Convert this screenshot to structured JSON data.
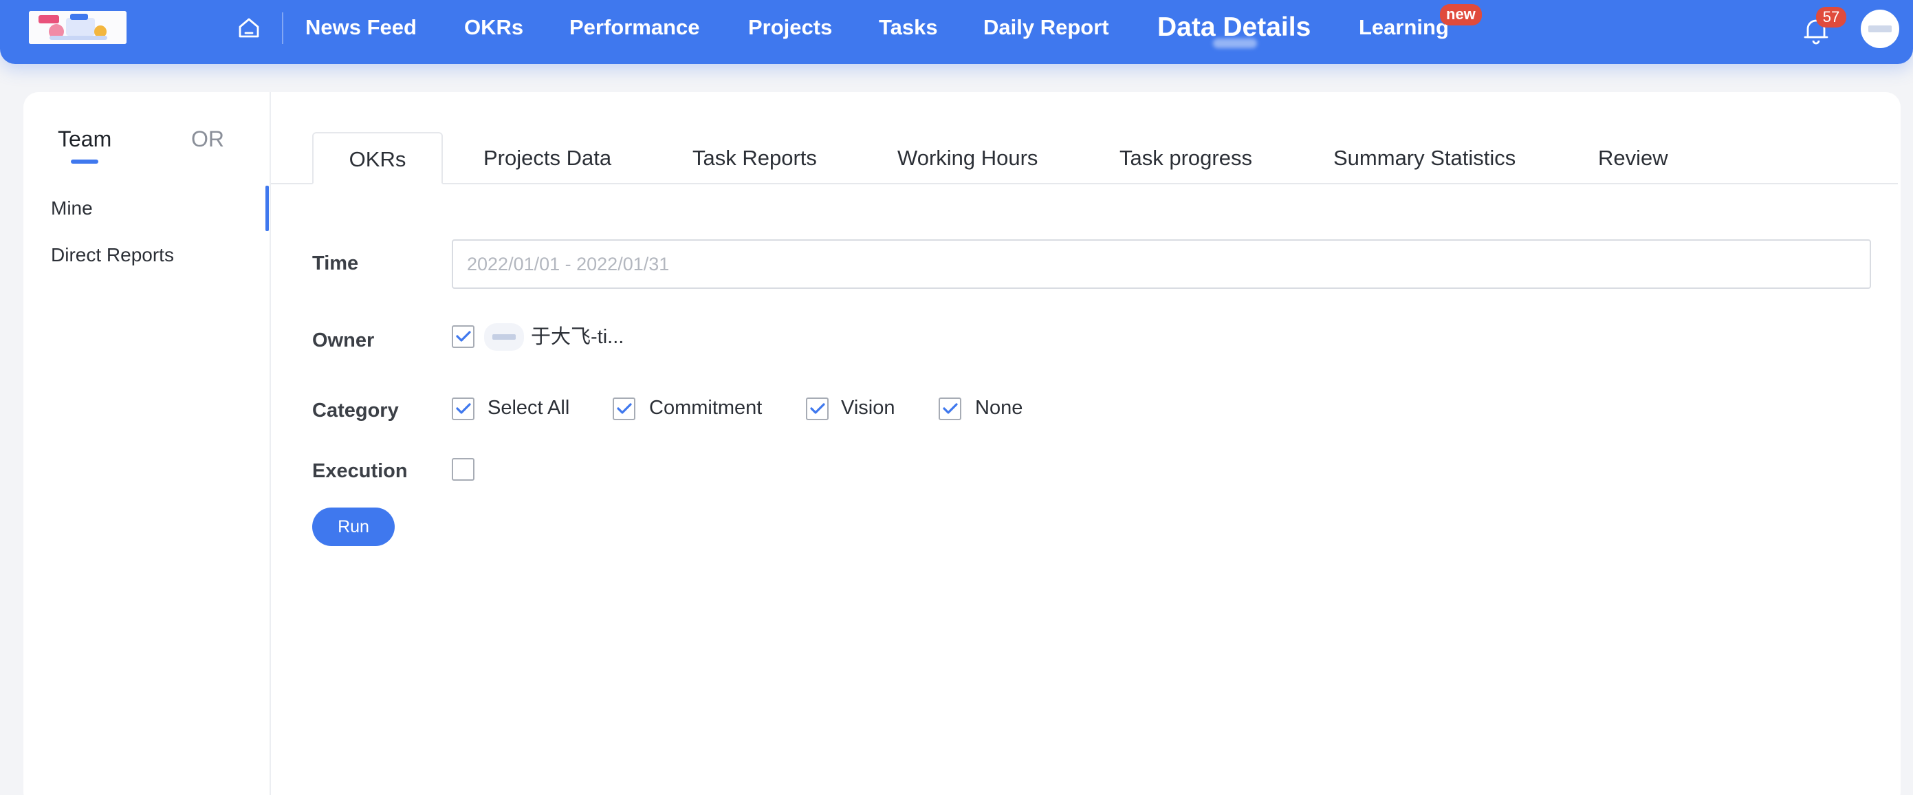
{
  "nav": {
    "items": [
      "News Feed",
      "OKRs",
      "Performance",
      "Projects",
      "Tasks",
      "Daily Report",
      "Data Details",
      "Learning"
    ],
    "active": "Data Details",
    "new_badge": "new",
    "notification_count": "57"
  },
  "sidebar": {
    "tabs": [
      "Team",
      "OR"
    ],
    "active_tab": "Team",
    "items": [
      "Mine",
      "Direct Reports"
    ],
    "active_item": "Mine"
  },
  "tabs": {
    "items": [
      "OKRs",
      "Projects Data",
      "Task Reports",
      "Working Hours",
      "Task progress",
      "Summary Statistics",
      "Review"
    ],
    "selected": "OKRs"
  },
  "form": {
    "time": {
      "label": "Time",
      "placeholder": "2022/01/01 - 2022/01/31",
      "value": ""
    },
    "owner": {
      "label": "Owner",
      "name": "于大飞-ti...",
      "checked": true
    },
    "category": {
      "label": "Category",
      "options": [
        {
          "label": "Select All",
          "checked": true
        },
        {
          "label": "Commitment",
          "checked": true
        },
        {
          "label": "Vision",
          "checked": true
        },
        {
          "label": "None",
          "checked": true
        }
      ]
    },
    "execution": {
      "label": "Execution",
      "checked": false
    },
    "run_label": "Run"
  },
  "colors": {
    "primary": "#3f78ee",
    "badge": "#e04b3c",
    "check": "#3f78ee"
  }
}
